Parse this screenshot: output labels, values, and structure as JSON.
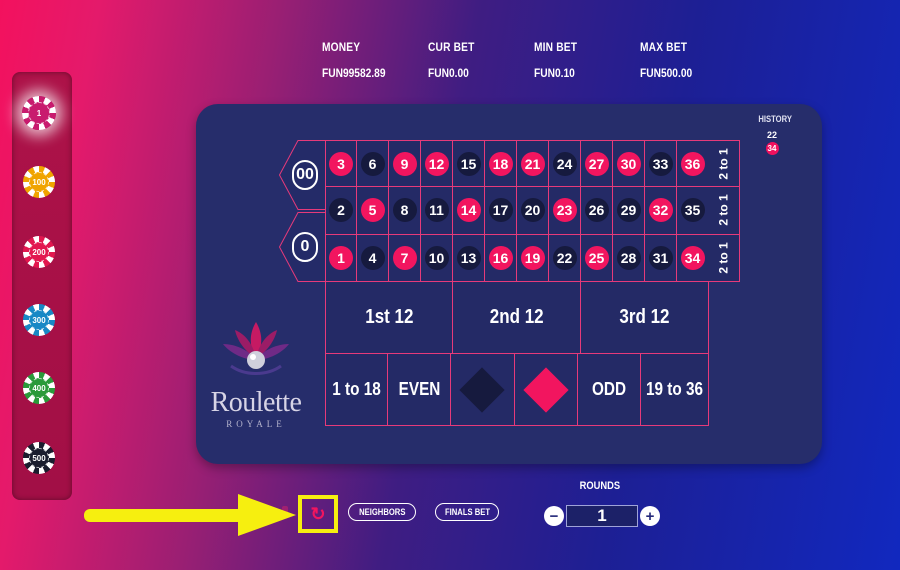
{
  "stats": [
    {
      "label": "MONEY",
      "value": "FUN99582.89"
    },
    {
      "label": "CUR BET",
      "value": "FUN0.00"
    },
    {
      "label": "MIN BET",
      "value": "FUN0.10"
    },
    {
      "label": "MAX BET",
      "value": "FUN500.00"
    }
  ],
  "chips": [
    {
      "value": "1",
      "color": "#c81b6e",
      "active": true
    },
    {
      "value": "100",
      "color": "#f0a400",
      "active": false
    },
    {
      "value": "200",
      "color": "#e2174f",
      "active": false
    },
    {
      "value": "300",
      "color": "#1888c5",
      "active": false
    },
    {
      "value": "400",
      "color": "#2a9a3a",
      "active": false
    },
    {
      "value": "500",
      "color": "#1a1d2e",
      "active": false
    }
  ],
  "history": {
    "title": "HISTORY",
    "items": [
      "22",
      "34"
    ]
  },
  "zeros": [
    "00",
    "0"
  ],
  "rows": [
    [
      {
        "n": "3",
        "c": "red"
      },
      {
        "n": "6",
        "c": "black"
      },
      {
        "n": "9",
        "c": "red"
      },
      {
        "n": "12",
        "c": "red"
      },
      {
        "n": "15",
        "c": "black"
      },
      {
        "n": "18",
        "c": "red"
      },
      {
        "n": "21",
        "c": "red"
      },
      {
        "n": "24",
        "c": "black"
      },
      {
        "n": "27",
        "c": "red"
      },
      {
        "n": "30",
        "c": "red"
      },
      {
        "n": "33",
        "c": "black"
      },
      {
        "n": "36",
        "c": "red"
      }
    ],
    [
      {
        "n": "2",
        "c": "black"
      },
      {
        "n": "5",
        "c": "red"
      },
      {
        "n": "8",
        "c": "black"
      },
      {
        "n": "11",
        "c": "black"
      },
      {
        "n": "14",
        "c": "red"
      },
      {
        "n": "17",
        "c": "black"
      },
      {
        "n": "20",
        "c": "black"
      },
      {
        "n": "23",
        "c": "red"
      },
      {
        "n": "26",
        "c": "black"
      },
      {
        "n": "29",
        "c": "black"
      },
      {
        "n": "32",
        "c": "red"
      },
      {
        "n": "35",
        "c": "black"
      }
    ],
    [
      {
        "n": "1",
        "c": "red"
      },
      {
        "n": "4",
        "c": "black"
      },
      {
        "n": "7",
        "c": "red"
      },
      {
        "n": "10",
        "c": "black"
      },
      {
        "n": "13",
        "c": "black"
      },
      {
        "n": "16",
        "c": "red"
      },
      {
        "n": "19",
        "c": "red"
      },
      {
        "n": "22",
        "c": "black"
      },
      {
        "n": "25",
        "c": "red"
      },
      {
        "n": "28",
        "c": "black"
      },
      {
        "n": "31",
        "c": "black"
      },
      {
        "n": "34",
        "c": "red"
      }
    ]
  ],
  "column_bets": [
    "2 to 1",
    "2 to 1",
    "2 to 1"
  ],
  "dozens": [
    "1st 12",
    "2nd 12",
    "3rd 12"
  ],
  "outside": {
    "low": "1 to 18",
    "even": "EVEN",
    "odd": "ODD",
    "high": "19 to 36"
  },
  "logo": {
    "word": "Roulette",
    "sub": "ROYALE"
  },
  "controls": {
    "undo_glyph": "↻",
    "neighbors": "NEIGHBORS",
    "finals": "FINALS BET",
    "rounds_label": "ROUNDS",
    "rounds_value": "1",
    "minus": "−",
    "plus": "+"
  },
  "colors": {
    "red": "#f2155f",
    "black": "#161a3e",
    "table": "#262d6b",
    "highlight": "#f6ef0f"
  }
}
